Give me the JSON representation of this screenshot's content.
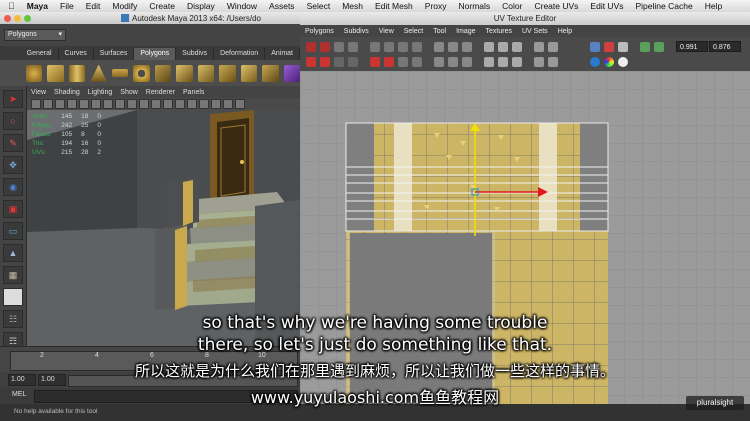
{
  "menubar": {
    "app": "Maya",
    "items": [
      "File",
      "Edit",
      "Modify",
      "Create",
      "Display",
      "Window",
      "Assets",
      "Select",
      "Mesh",
      "Edit Mesh",
      "Proxy",
      "Normals",
      "Color",
      "Create UVs",
      "Edit UVs",
      "Pipeline Cache",
      "Help"
    ]
  },
  "maya_window": {
    "title": "Autodesk Maya 2013 x64: /Users/do",
    "menu_set": "Polygons",
    "shelf_tabs": [
      "General",
      "Curves",
      "Surfaces",
      "Polygons",
      "Subdivs",
      "Deformation",
      "Animat"
    ],
    "active_shelf_tab": "Polygons",
    "viewport_menu": [
      "View",
      "Shading",
      "Lighting",
      "Show",
      "Renderer",
      "Panels"
    ],
    "hud_rows": [
      {
        "label": "Verts:",
        "a": "145",
        "b": "18",
        "c": "0"
      },
      {
        "label": "Edges:",
        "a": "242",
        "b": "25",
        "c": "0"
      },
      {
        "label": "Faces:",
        "a": "105",
        "b": "8",
        "c": "0"
      },
      {
        "label": "Tris:",
        "a": "194",
        "b": "16",
        "c": "0"
      },
      {
        "label": "UVs:",
        "a": "215",
        "b": "28",
        "c": "2"
      }
    ],
    "time_ticks": [
      "2",
      "4",
      "6",
      "8",
      "10"
    ],
    "range_start": "1.00",
    "range_current": "1.00",
    "mel_label": "MEL",
    "help_text": "No help available for this tool"
  },
  "uv_editor": {
    "title": "UV Texture Editor",
    "menu": [
      "Polygons",
      "Subdivs",
      "View",
      "Select",
      "Tool",
      "Image",
      "Textures",
      "UV Sets",
      "Help"
    ],
    "u_value": "0.991",
    "v_value": "0.876"
  },
  "subtitles": {
    "en_line1": "so that's why we're having some trouble",
    "en_line2": "there, so let's just do something like that.",
    "cn_line": "所以这就是为什么我们在那里遇到麻烦，所以让我们做一些这样的事情。",
    "url_line": "www.yuyulaoshi.com鱼鱼教程网"
  },
  "watermark": "pluralsight",
  "colors": {
    "uv_gold": "#cdb566",
    "uv_gray": "#7d7d7d",
    "manip_red": "#e01a1a",
    "manip_yellow": "#f2e000",
    "hud_green": "#38b050"
  }
}
